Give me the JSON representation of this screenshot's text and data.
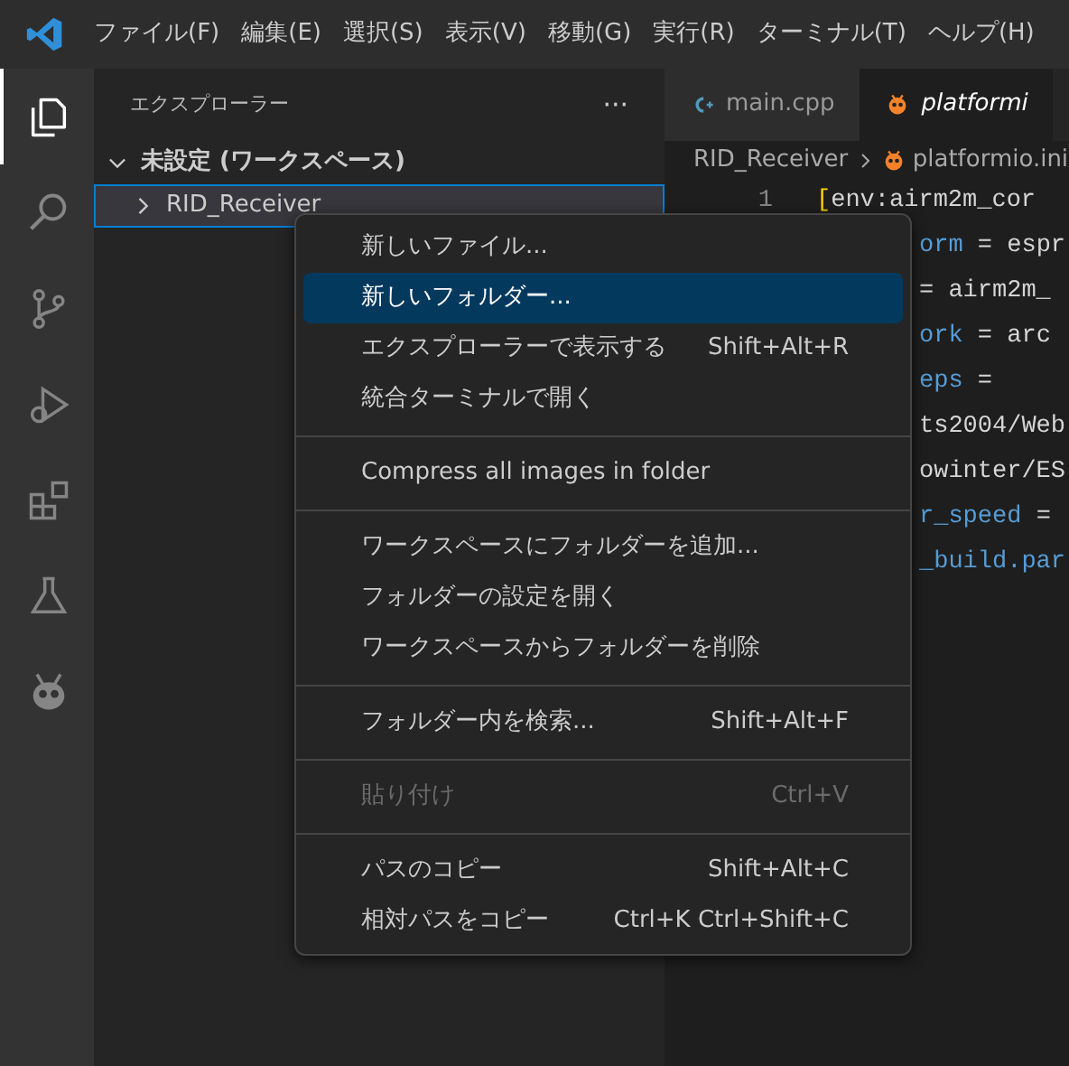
{
  "menu_bar": [
    "ファイル(F)",
    "編集(E)",
    "選択(S)",
    "表示(V)",
    "移動(G)",
    "実行(R)",
    "ターミナル(T)",
    "ヘルプ(H)"
  ],
  "activity_bar": [
    {
      "kind": "files",
      "selected": true
    },
    {
      "kind": "search",
      "selected": false
    },
    {
      "kind": "source-control",
      "selected": false
    },
    {
      "kind": "run",
      "selected": false
    },
    {
      "kind": "extensions",
      "selected": false
    },
    {
      "kind": "testing",
      "selected": false
    },
    {
      "kind": "platformio",
      "selected": false
    }
  ],
  "sidebar": {
    "title": "エクスプローラー",
    "more": "···",
    "tree": [
      {
        "label": "未設定 (ワークスペース)",
        "expanded": true,
        "children": [
          {
            "label": "RID_Receiver",
            "expanded": false,
            "focused": true
          }
        ]
      }
    ]
  },
  "tabs": [
    {
      "label": "main.cpp",
      "kind": "cpp",
      "selected": false
    },
    {
      "label": "platformi",
      "kind": "platformio",
      "selected": true
    }
  ],
  "breadcrumb": [
    {
      "label": "RID_Receiver",
      "kind": "folder"
    },
    {
      "label": "platformio.ini",
      "kind": "platformio"
    }
  ],
  "code_lines": [
    {
      "number": "1",
      "segments": [
        {
          "text": "[",
          "kind": "bracket"
        },
        {
          "text": "env:airm2m_cor",
          "kind": "value"
        }
      ]
    },
    {
      "segments": [
        {
          "text": "orm",
          "kind": "key"
        },
        {
          "text": " = espr",
          "kind": "value"
        }
      ]
    },
    {
      "segments": [
        {
          "text": "= airm2m_",
          "kind": "value"
        }
      ]
    },
    {
      "segments": [
        {
          "text": "ork",
          "kind": "key"
        },
        {
          "text": " = arc",
          "kind": "value"
        }
      ]
    },
    {
      "segments": [
        {
          "text": "eps",
          "kind": "key"
        },
        {
          "text": " =",
          "kind": "value"
        }
      ]
    },
    {
      "segments": [
        {
          "text": "ts2004/Web",
          "kind": "value"
        }
      ]
    },
    {
      "segments": [
        {
          "text": "owinter/ES",
          "kind": "value"
        }
      ]
    },
    {
      "segments": [
        {
          "text": "r_speed",
          "kind": "key"
        },
        {
          "text": " =",
          "kind": "value"
        }
      ]
    },
    {
      "segments": [
        {
          "text": "_build.par",
          "kind": "key"
        }
      ]
    }
  ],
  "context_menu": {
    "groups": [
      [
        {
          "label": "新しいファイル...",
          "selected": false,
          "disabled": false
        },
        {
          "label": "新しいフォルダー...",
          "selected": true,
          "disabled": false
        },
        {
          "label": "エクスプローラーで表示する",
          "shortcut": "Shift+Alt+R",
          "selected": false,
          "disabled": false
        },
        {
          "label": "統合ターミナルで開く",
          "selected": false,
          "disabled": false
        }
      ],
      [
        {
          "label": "Compress all images in folder",
          "selected": false,
          "disabled": false
        }
      ],
      [
        {
          "label": "ワークスペースにフォルダーを追加...",
          "selected": false,
          "disabled": false
        },
        {
          "label": "フォルダーの設定を開く",
          "selected": false,
          "disabled": false
        },
        {
          "label": "ワークスペースからフォルダーを削除",
          "selected": false,
          "disabled": false
        }
      ],
      [
        {
          "label": "フォルダー内を検索...",
          "shortcut": "Shift+Alt+F",
          "selected": false,
          "disabled": false
        }
      ],
      [
        {
          "label": "貼り付け",
          "shortcut": "Ctrl+V",
          "selected": false,
          "disabled": true
        }
      ],
      [
        {
          "label": "パスのコピー",
          "shortcut": "Shift+Alt+C",
          "selected": false,
          "disabled": false
        },
        {
          "label": "相対パスをコピー",
          "shortcut": "Ctrl+K Ctrl+Shift+C",
          "selected": false,
          "disabled": false
        }
      ]
    ]
  }
}
